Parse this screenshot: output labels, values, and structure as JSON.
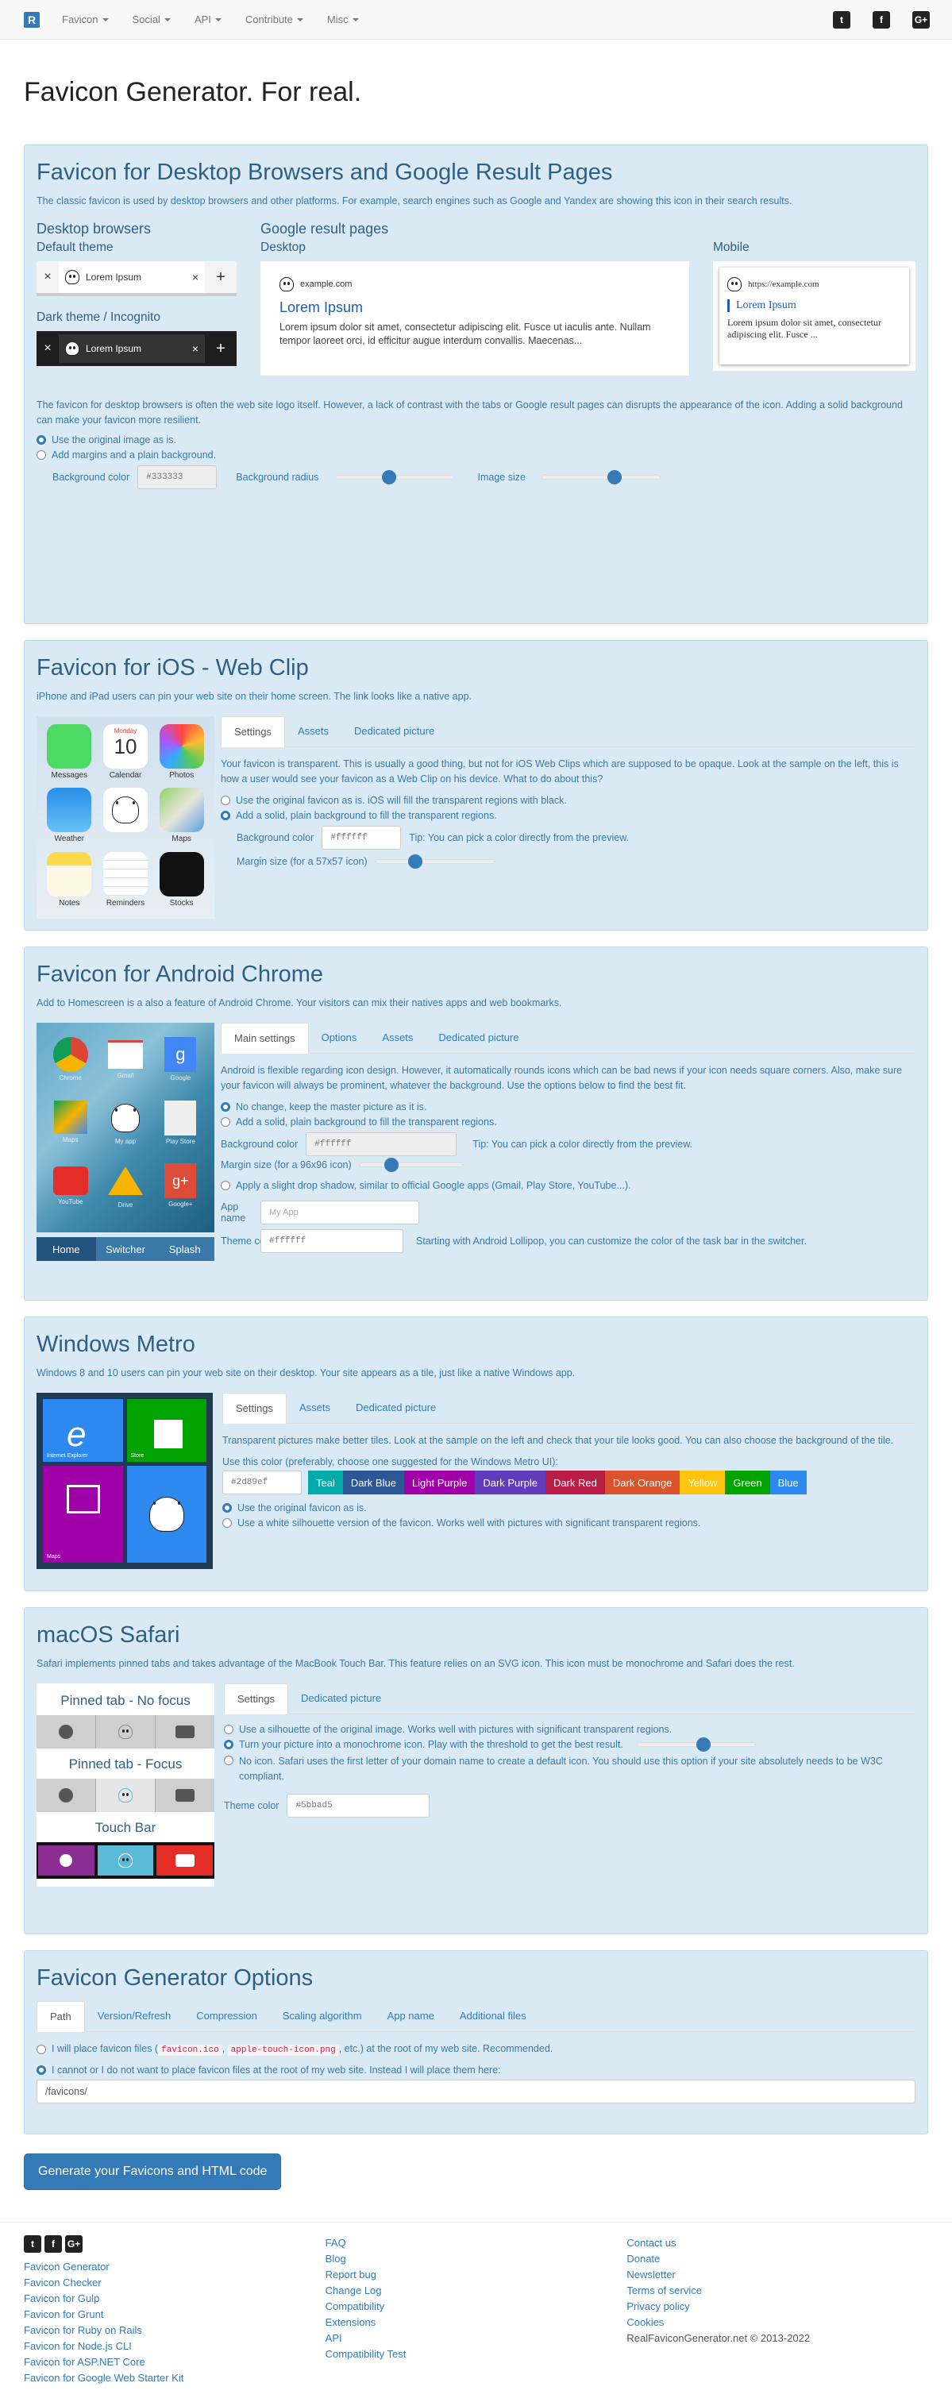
{
  "nav": {
    "logo": "R",
    "items": [
      "Favicon",
      "Social",
      "API",
      "Contribute",
      "Misc"
    ],
    "social": [
      "twitter-icon",
      "facebook-icon",
      "google-plus-icon"
    ]
  },
  "title": "Favicon Generator. For real.",
  "desktop": {
    "heading": "Favicon for Desktop Browsers and Google Result Pages",
    "intro": "The classic favicon is used by desktop browsers and other platforms. For example, search engines such as Google and Yandex are showing this icon in their search results.",
    "browsers_heading": "Desktop browsers",
    "default_theme": "Default theme",
    "dark_theme": "Dark theme / Incognito",
    "tab_label": "Lorem Ipsum",
    "google_heading": "Google result pages",
    "desktop_label": "Desktop",
    "mobile_label": "Mobile",
    "g_desktop_url": "example.com",
    "g_desktop_title": "Lorem Ipsum",
    "g_desktop_text": "Lorem ipsum dolor sit amet, consectetur adipiscing elit. Fusce ut iaculis ante. Nullam tempor laoreet orci, id efficitur augue interdum convallis. Maecenas...",
    "g_mobile_url": "https://example.com",
    "g_mobile_title": "Lorem Ipsum",
    "g_mobile_text": "Lorem ipsum dolor sit amet, consectetur adipiscing elit. Fusce ...",
    "info": "The favicon for desktop browsers is often the web site logo itself. However, a lack of contrast with the tabs or Google result pages can disrupts the appearance of the icon. Adding a solid background can make your favicon more resilient.",
    "opt_original": "Use the original image as is.",
    "opt_margins": "Add margins and a plain background.",
    "bg_color_label": "Background color",
    "bg_color_value": "#333333",
    "bg_radius_label": "Background radius",
    "image_size_label": "Image size"
  },
  "ios": {
    "heading": "Favicon for iOS - Web Clip",
    "intro": "iPhone and iPad users can pin your web site on their home screen. The link looks like a native app.",
    "apps": [
      "Messages",
      "Calendar",
      "Photos",
      "Weather",
      "",
      "Maps",
      "Notes",
      "Reminders",
      "Stocks"
    ],
    "calendar_day": "Monday",
    "calendar_num": "10",
    "tabs": [
      "Settings",
      "Assets",
      "Dedicated picture"
    ],
    "info": "Your favicon is transparent. This is usually a good thing, but not for iOS Web Clips which are supposed to be opaque. Look at the sample on the left, this is how a user would see your favicon as a Web Clip on his device. What to do about this?",
    "opt_original": "Use the original favicon as is. iOS will fill the transparent regions with black.",
    "opt_solid": "Add a solid, plain background to fill the transparent regions.",
    "bg_label": "Background color",
    "bg_value": "#ffffff",
    "tip": "Tip: You can pick a color directly from the preview.",
    "margin_label": "Margin size (for a 57x57 icon)"
  },
  "android": {
    "heading": "Favicon for Android Chrome",
    "intro": "Add to Homescreen is a also a feature of Android Chrome. Your visitors can mix their natives apps and web bookmarks.",
    "apps": [
      "Chrome",
      "Gmail",
      "Google",
      "Maps",
      "My app",
      "Play Store",
      "YouTube",
      "Drive",
      "Google+"
    ],
    "bottom_tabs": [
      "Home",
      "Switcher",
      "Splash"
    ],
    "tabs": [
      "Main settings",
      "Options",
      "Assets",
      "Dedicated picture"
    ],
    "info": "Android is flexible regarding icon design. However, it automatically rounds icons which can be bad news if your icon needs square corners. Also, make sure your favicon will always be prominent, whatever the background. Use the options below to find the best fit.",
    "opt_nochange": "No change, keep the master picture as it is.",
    "opt_solid": "Add a solid, plain background to fill the transparent regions.",
    "bg_label": "Background color",
    "bg_value": "#ffffff",
    "tip": "Tip: You can pick a color directly from the preview.",
    "margin_label": "Margin size (for a 96x96 icon)",
    "opt_shadow": "Apply a slight drop shadow, similar to official Google apps (Gmail, Play Store, YouTube...).",
    "appname_label": "App name",
    "appname_placeholder": "My App",
    "theme_label": "Theme color",
    "theme_value": "#ffffff",
    "theme_note": "Starting with Android Lollipop, you can customize the color of the task bar in the switcher."
  },
  "metro": {
    "heading": "Windows Metro",
    "intro": "Windows 8 and 10 users can pin your web site on their desktop. Your site appears as a tile, just like a native Windows app.",
    "tiles": [
      "Internet Explorer",
      "Store",
      "Maps",
      ""
    ],
    "tabs": [
      "Settings",
      "Assets",
      "Dedicated picture"
    ],
    "info": "Transparent pictures make better tiles. Look at the sample on the left and check that your tile looks good. You can also choose the background of the tile.",
    "color_label": "Use this color (preferably, choose one suggested for the Windows Metro UI):",
    "color_value": "#2d89ef",
    "colors": [
      {
        "name": "Teal",
        "hex": "#00aba9"
      },
      {
        "name": "Dark Blue",
        "hex": "#2b5797"
      },
      {
        "name": "Light Purple",
        "hex": "#9f00a7"
      },
      {
        "name": "Dark Purple",
        "hex": "#603cba"
      },
      {
        "name": "Dark Red",
        "hex": "#b91d47"
      },
      {
        "name": "Dark Orange",
        "hex": "#da532c"
      },
      {
        "name": "Yellow",
        "hex": "#ffc40d"
      },
      {
        "name": "Green",
        "hex": "#00a300"
      },
      {
        "name": "Blue",
        "hex": "#2d89ef"
      }
    ],
    "opt_original": "Use the original favicon as is.",
    "opt_white": "Use a white silhouette version of the favicon. Works well with pictures with significant transparent regions."
  },
  "safari": {
    "heading": "macOS Safari",
    "intro": "Safari implements pinned tabs and takes advantage of the MacBook Touch Bar. This feature relies on an SVG icon. This icon must be monochrome and Safari does the rest.",
    "no_focus": "Pinned tab - No focus",
    "focus": "Pinned tab - Focus",
    "touchbar": "Touch Bar",
    "tabs": [
      "Settings",
      "Dedicated picture"
    ],
    "opt_silhouette": "Use a silhouette of the original image. Works well with pictures with significant transparent regions.",
    "opt_mono": "Turn your picture into a monochrome icon. Play with the threshold to get the best result.",
    "opt_noicon": "No icon. Safari uses the first letter of your domain name to create a default icon. You should use this option if your site absolutely needs to be W3C compliant.",
    "theme_label": "Theme color",
    "theme_value": "#5bbad5"
  },
  "options": {
    "heading": "Favicon Generator Options",
    "tabs": [
      "Path",
      "Version/Refresh",
      "Compression",
      "Scaling algorithm",
      "App name",
      "Additional files"
    ],
    "opt_root_a": "I will place favicon files (",
    "code1": "favicon.ico",
    "sep": ", ",
    "code2": "apple-touch-icon.png",
    "opt_root_b": ", etc.) at the root of my web site. Recommended.",
    "opt_path": "I cannot or I do not want to place favicon files at the root of my web site. Instead I will place them here:",
    "path_value": "/favicons/"
  },
  "generate_button": "Generate your Favicons and HTML code",
  "footer": {
    "col1": [
      "Favicon Generator",
      "Favicon Checker",
      "Favicon for Gulp",
      "Favicon for Grunt",
      "Favicon for Ruby on Rails",
      "Favicon for Node.js CLI",
      "Favicon for ASP.NET Core",
      "Favicon for Google Web Starter Kit"
    ],
    "col2": [
      "FAQ",
      "Blog",
      "Report bug",
      "Change Log",
      "Compatibility",
      "Extensions",
      "API",
      "Compatibility Test"
    ],
    "col3": [
      "Contact us",
      "Donate",
      "Newsletter",
      "Terms of service",
      "Privacy policy",
      "Cookies"
    ],
    "copyright": "RealFaviconGenerator.net © 2013-2022"
  }
}
